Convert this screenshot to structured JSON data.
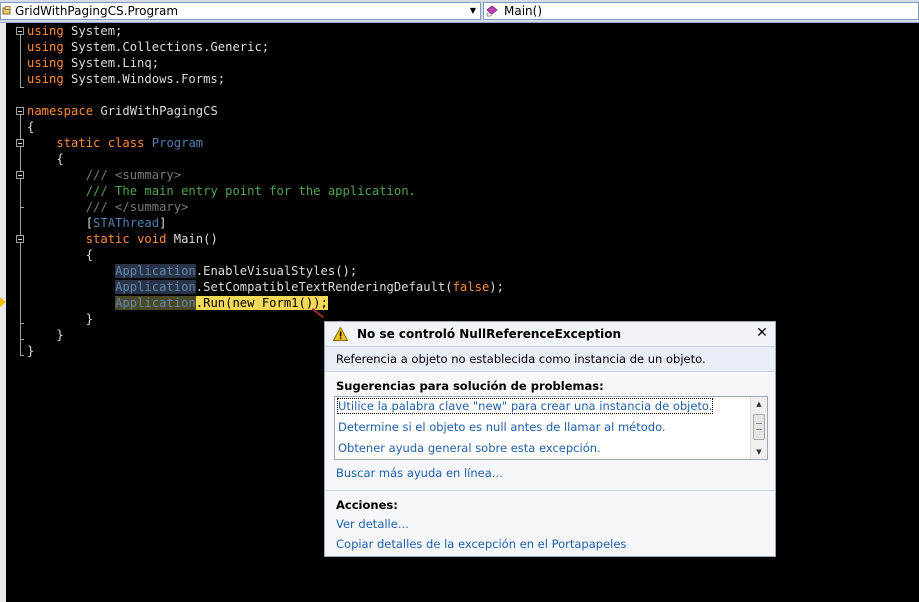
{
  "navbar": {
    "class_selector": "GridWithPagingCS.Program",
    "member_selector": "Main()"
  },
  "code_lines": [
    {
      "n": 0,
      "parts": [
        [
          "kw",
          "using"
        ],
        [
          "t",
          " System;"
        ]
      ]
    },
    {
      "n": 1,
      "parts": [
        [
          "kw",
          "using"
        ],
        [
          "t",
          " System.Collections.Generic;"
        ]
      ]
    },
    {
      "n": 2,
      "parts": [
        [
          "kw",
          "using"
        ],
        [
          "t",
          " System.Linq;"
        ]
      ]
    },
    {
      "n": 3,
      "parts": [
        [
          "kw",
          "using"
        ],
        [
          "t",
          " System.Windows.Forms;"
        ]
      ]
    },
    {
      "n": 5,
      "parts": [
        [
          "kw",
          "namespace"
        ],
        [
          "t",
          " GridWithPagingCS"
        ]
      ]
    },
    {
      "n": 6,
      "parts": [
        [
          "t",
          "{"
        ]
      ]
    },
    {
      "n": 7,
      "parts": [
        [
          "t",
          "    "
        ],
        [
          "kw",
          "static class"
        ],
        [
          "t",
          " "
        ],
        [
          "type",
          "Program"
        ]
      ]
    },
    {
      "n": 8,
      "parts": [
        [
          "t",
          "    {"
        ]
      ]
    },
    {
      "n": 9,
      "parts": [
        [
          "t",
          "        "
        ],
        [
          "cm-tag",
          "/// <summary>"
        ]
      ]
    },
    {
      "n": 10,
      "parts": [
        [
          "t",
          "        "
        ],
        [
          "cm",
          "/// The main entry point for the application."
        ]
      ]
    },
    {
      "n": 11,
      "parts": [
        [
          "t",
          "        "
        ],
        [
          "cm-tag",
          "/// </summary>"
        ]
      ]
    },
    {
      "n": 12,
      "parts": [
        [
          "t",
          "        ["
        ],
        [
          "attr",
          "STAThread"
        ],
        [
          "t",
          "]"
        ]
      ]
    },
    {
      "n": 13,
      "parts": [
        [
          "t",
          "        "
        ],
        [
          "kw",
          "static void"
        ],
        [
          "t",
          " Main()"
        ]
      ]
    },
    {
      "n": 14,
      "parts": [
        [
          "t",
          "        {"
        ]
      ]
    },
    {
      "n": 15,
      "parts": [
        [
          "t",
          "            "
        ],
        [
          "hl-type",
          "Application"
        ],
        [
          "t",
          ".EnableVisualStyles();"
        ]
      ]
    },
    {
      "n": 16,
      "parts": [
        [
          "t",
          "            "
        ],
        [
          "hl-type",
          "Application"
        ],
        [
          "t",
          ".SetCompatibleTextRenderingDefault("
        ],
        [
          "kw",
          "false"
        ],
        [
          "t",
          ");"
        ]
      ]
    },
    {
      "n": 17,
      "parts": [
        [
          "t",
          "            "
        ],
        [
          "hl-type-stmt",
          "Application"
        ],
        [
          "hl-stmt",
          ".Run(new Form1());"
        ]
      ]
    },
    {
      "n": 18,
      "parts": [
        [
          "t",
          "        }"
        ]
      ]
    },
    {
      "n": 19,
      "parts": [
        [
          "t",
          "    }"
        ]
      ]
    },
    {
      "n": 20,
      "parts": [
        [
          "t",
          "}"
        ]
      ]
    }
  ],
  "exception": {
    "title": "No se controló NullReferenceException",
    "message": "Referencia a objeto no establecida como instancia de un objeto.",
    "suggestions_heading": "Sugerencias para solución de problemas:",
    "suggestions": [
      "Utilice la palabra clave \"new\" para crear una instancia de objeto.",
      "Determine si el objeto es null antes de llamar al método.",
      "Obtener ayuda general sobre esta excepción."
    ],
    "more_help_link": "Buscar más ayuda en línea...",
    "actions_heading": "Acciones:",
    "actions": [
      "Ver detalle...",
      "Copiar detalles de la excepción en el Portapapeles"
    ],
    "close_symbol": "✕"
  },
  "colors": {
    "keyword": "#ff8c3a",
    "type": "#4f7fb0",
    "comment": "#4fa64f",
    "current_statement": "#f3d955",
    "link": "#1f5fa8"
  }
}
